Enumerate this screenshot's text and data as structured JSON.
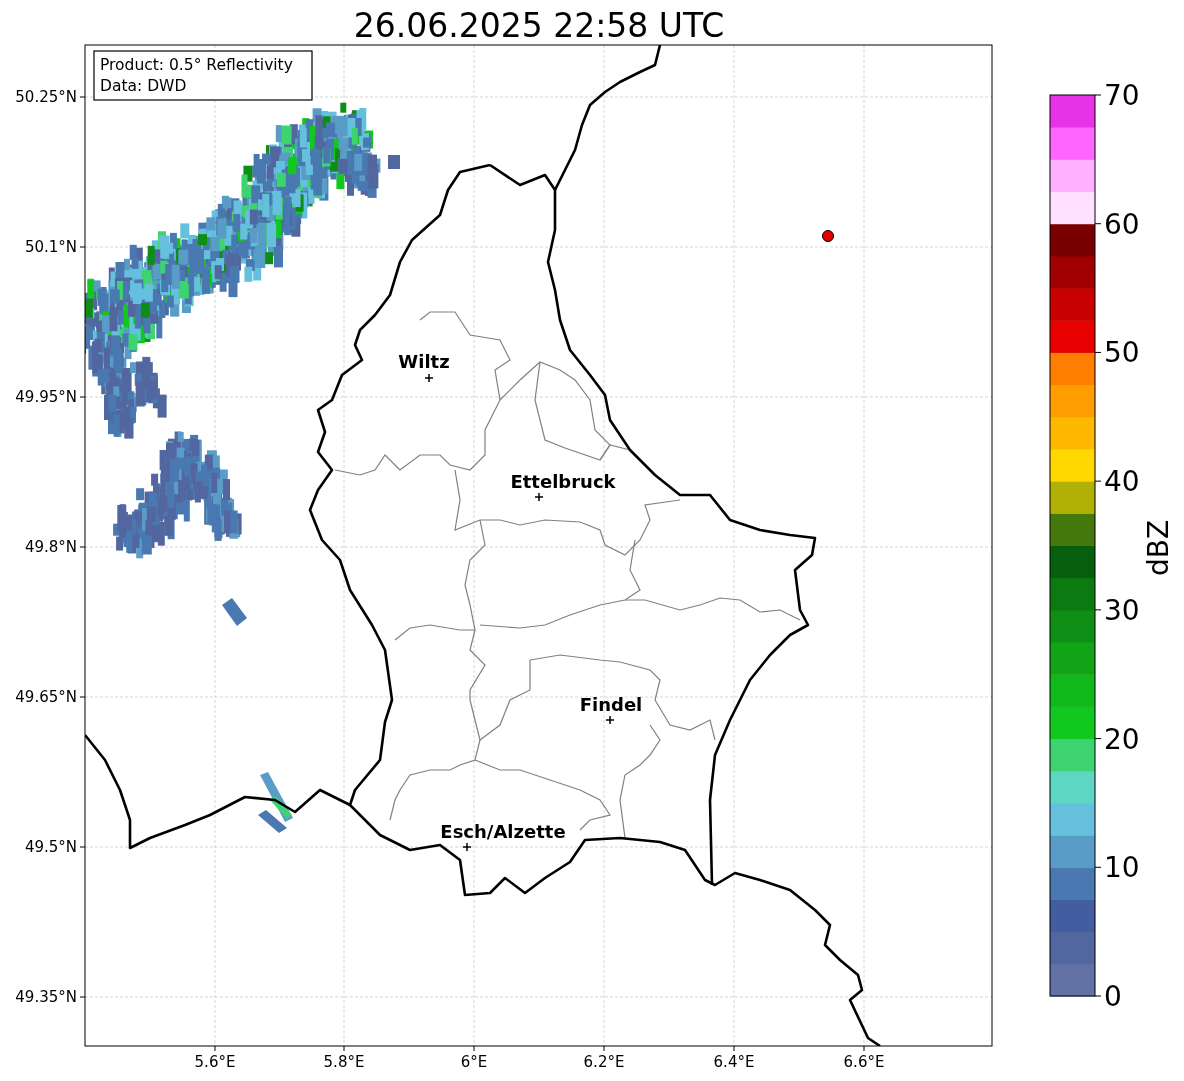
{
  "title": "26.06.2025 22:58 UTC",
  "info_box": {
    "lines": [
      "Product: 0.5° Reflectivity",
      "Data: DWD"
    ]
  },
  "map": {
    "x_axis_labels": [
      "5.6°E",
      "5.8°E",
      "6°E",
      "6.2°E",
      "6.4°E",
      "6.6°E"
    ],
    "y_axis_labels": [
      "50.25°N",
      "50.1°N",
      "49.95°N",
      "49.8°N",
      "49.65°N",
      "49.5°N",
      "49.35°N"
    ],
    "cities": [
      {
        "name": "Wiltz"
      },
      {
        "name": "Ettelbruck"
      },
      {
        "name": "Findel"
      },
      {
        "name": "Esch/Alzette"
      }
    ]
  },
  "colorbar": {
    "label": "dBZ",
    "ticks": [
      "70",
      "60",
      "50",
      "40",
      "30",
      "20",
      "10",
      "0"
    ],
    "bins": [
      {
        "color": "#6272a4"
      },
      {
        "color": "#52669f"
      },
      {
        "color": "#435ea0"
      },
      {
        "color": "#4a78b0"
      },
      {
        "color": "#5a9cc8"
      },
      {
        "color": "#64c0dc"
      },
      {
        "color": "#5dd6c4"
      },
      {
        "color": "#3dd470"
      },
      {
        "color": "#11c91e"
      },
      {
        "color": "#10b81a"
      },
      {
        "color": "#10a416"
      },
      {
        "color": "#0e8e14"
      },
      {
        "color": "#0b7a10"
      },
      {
        "color": "#075e0c"
      },
      {
        "color": "#44780c"
      },
      {
        "color": "#b0b005"
      },
      {
        "color": "#ffd800"
      },
      {
        "color": "#ffb800"
      },
      {
        "color": "#ff9c00"
      },
      {
        "color": "#ff7e00"
      },
      {
        "color": "#e60000"
      },
      {
        "color": "#c80000"
      },
      {
        "color": "#a00000"
      },
      {
        "color": "#780000"
      },
      {
        "color": "#ffe0ff"
      },
      {
        "color": "#ffb0ff"
      },
      {
        "color": "#ff66ff"
      },
      {
        "color": "#e832e8"
      }
    ]
  }
}
